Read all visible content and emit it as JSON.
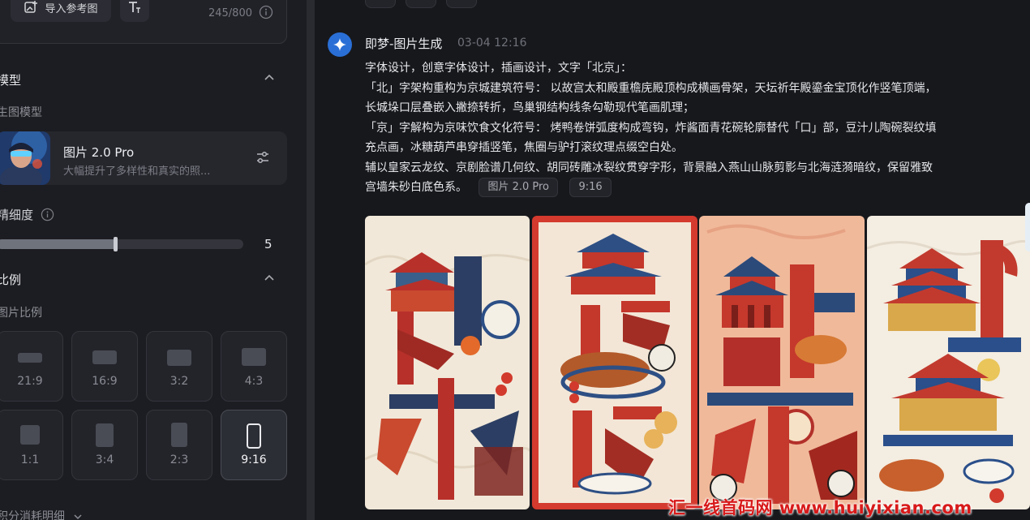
{
  "toolbar": {
    "import_ref_label": "导入参考图",
    "text_tool_icon": "text-format-icon",
    "char_count": "245/800"
  },
  "model_section": {
    "title": "模型",
    "sub_label": "生图模型",
    "model": {
      "name": "图片 2.0 Pro",
      "description": "大幅提升了多样性和真实的照..."
    }
  },
  "detail_section": {
    "title": "精细度",
    "value": "5",
    "value_fraction": 0.48
  },
  "ratio_section": {
    "title": "比例",
    "sub_label": "图片比例",
    "options": [
      {
        "label": "21:9"
      },
      {
        "label": "16:9"
      },
      {
        "label": "3:2"
      },
      {
        "label": "4:3"
      },
      {
        "label": "1:1"
      },
      {
        "label": "3:4"
      },
      {
        "label": "2:3"
      },
      {
        "label": "9:16"
      }
    ],
    "selected": "9:16"
  },
  "credits": {
    "label": "积分消耗明细"
  },
  "message": {
    "sender": "即梦-图片生成",
    "timestamp": "03-04  12:16",
    "lines": [
      "字体设计，创意字体设计，插画设计，文字「北京」：",
      "「北」字架构重构为京城建筑符号： 以故宫太和殿重檐庑殿顶构成横画骨架，天坛祈年殿鎏金宝顶化作竖笔顶端，",
      "长城垛口层叠嵌入撇捺转折，鸟巢钢结构线条勾勒现代笔画肌理；",
      "「京」字解构为京味饮食文化符号： 烤鸭卷饼弧度构成弯钩，炸酱面青花碗轮廓替代「口」部，豆汁儿陶碗裂纹填",
      "充点画，冰糖葫芦串穿插竖笔，焦圈与驴打滚纹理点缀空白处。",
      "辅以皇家云龙纹、京剧脸谱几何纹、胡同砖雕冰裂纹贯穿字形，背景融入燕山山脉剪影与北海涟漪暗纹，保留雅致",
      "宫墙朱砂白底色系。"
    ],
    "model_chip": "图片 2.0 Pro",
    "ratio_chip": "9:16"
  },
  "watermark": "汇一线首码网 www.huiyixian.com",
  "colors": {
    "accent_blue": "#2a6fd6",
    "panel_bg": "#1c1d22",
    "chat_bg": "#17181c",
    "vermilion": "#c8322a"
  }
}
